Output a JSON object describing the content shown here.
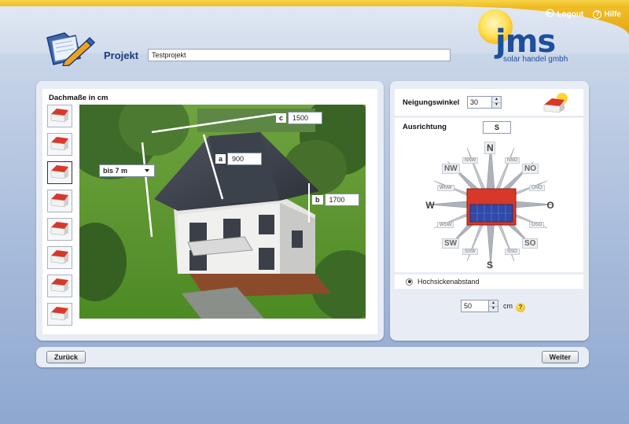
{
  "top_links": {
    "logout": "Logout",
    "help": "Hilfe"
  },
  "header": {
    "project_label": "Projekt",
    "project_value": "Testprojekt"
  },
  "logo": {
    "name": "jms",
    "tagline": "solar handel gmbh"
  },
  "roof_section": {
    "title": "Dachmaße in cm",
    "height_select": "bis 7 m",
    "dimensions": [
      {
        "letter": "c",
        "value": "1500"
      },
      {
        "letter": "a",
        "value": "900"
      },
      {
        "letter": "b",
        "value": "1700"
      }
    ],
    "roof_types_count": 8,
    "selected_roof_type_index": 2
  },
  "tilt": {
    "label": "Neigungswinkel",
    "value": "30"
  },
  "orientation": {
    "label": "Ausrichtung",
    "value": "S",
    "main": {
      "n": "N",
      "e": "O",
      "s": "S",
      "w": "W"
    },
    "inter": {
      "nw": "NW",
      "no": "NO",
      "sw": "SW",
      "so": "SO"
    },
    "fine": {
      "nnw": "NNW",
      "nno": "NNO",
      "wnw": "WNW",
      "ono": "ONO",
      "wsw": "WSW",
      "oso": "OSO",
      "ssw": "SSW",
      "sso": "SSO"
    }
  },
  "spacing": {
    "option_label": "Hochsickenabstand",
    "value": "50",
    "unit": "cm"
  },
  "buttons": {
    "back": "Zurück",
    "next": "Weiter"
  },
  "colors": {
    "accent_yellow": "#efb91a",
    "brand_blue": "#1d4f9c",
    "roof_red": "#d8382a"
  }
}
